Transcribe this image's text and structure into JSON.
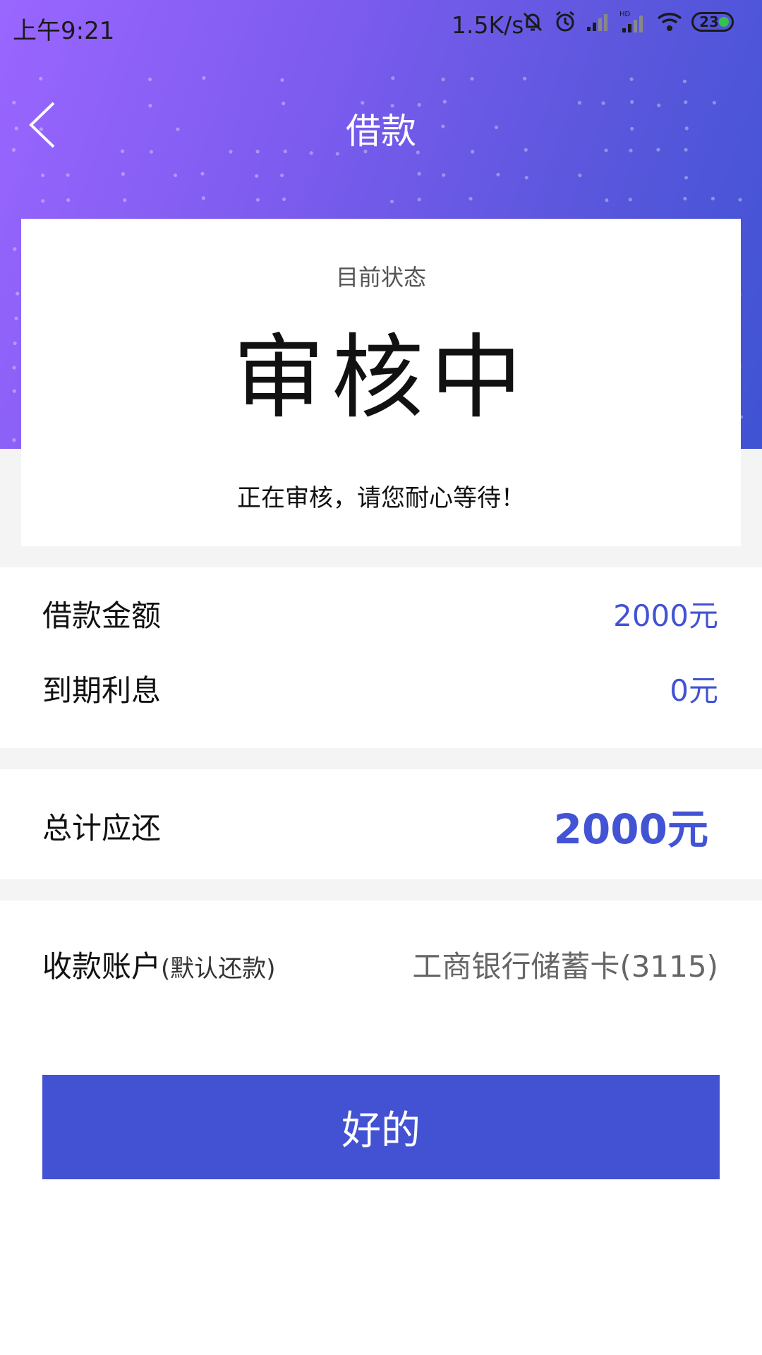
{
  "status_bar": {
    "time": "上午9:21",
    "network_speed": "1.5K/s",
    "battery_level": "23",
    "icons": [
      "mute-bell-icon",
      "alarm-icon",
      "signal-icon",
      "signal-hd-icon",
      "wifi-icon",
      "battery-icon"
    ]
  },
  "header": {
    "title": "借款",
    "back_icon": "back-chevron-icon"
  },
  "status_card": {
    "label": "目前状态",
    "status": "审核中",
    "message": "正在审核，请您耐心等待！"
  },
  "details": {
    "amount_label": "借款金额",
    "amount_value": "2000元",
    "interest_label": "到期利息",
    "interest_value": "0元"
  },
  "total": {
    "label": "总计应还",
    "value": "2000元"
  },
  "account": {
    "label": "收款账户",
    "sub_label": "(默认还款)",
    "value": "工商银行储蓄卡(3115)"
  },
  "confirm_button": "好的",
  "colors": {
    "accent": "#4252d2",
    "gradient_start": "#9a66ff",
    "gradient_end": "#3f53d3",
    "divider_gray": "#f4f4f4"
  }
}
